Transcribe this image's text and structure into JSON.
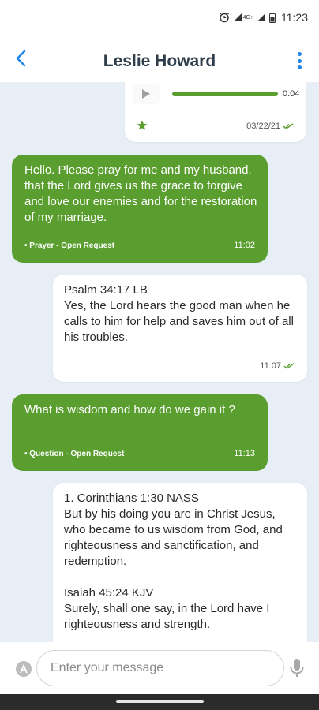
{
  "status": {
    "time": "11:23",
    "network": "4G+"
  },
  "header": {
    "title": "Leslie Howard"
  },
  "messages": [
    {
      "type": "audio",
      "duration": "0:04",
      "date": "03/22/21"
    },
    {
      "type": "incoming",
      "text": "Hello. Please pray for me and my husband, that the Lord gives us the grace to forgive and love our enemies and for the restoration of my marriage.",
      "tag": "• Prayer - Open Request",
      "time": "11:02"
    },
    {
      "type": "outgoing",
      "text": "Psalm 34:17 LB\nYes, the Lord hears the good man when he calls to him for help and saves him out of all his troubles.",
      "time": "11:07"
    },
    {
      "type": "incoming",
      "text": "What is wisdom and how do we gain it ?",
      "tag": "• Question - Open Request",
      "time": "11:13"
    },
    {
      "type": "outgoing",
      "text": "1. Corinthians 1:30 NASS\nBut by his doing you are in Christ Jesus, who became to us wisdom from God, and righteousness and sanctification, and redemption.\n\nIsaiah 45:24 KJV\nSurely, shall one say, in the Lord have I righteousness and strength."
    }
  ],
  "composer": {
    "placeholder": "Enter your message"
  },
  "colors": {
    "accent": "#1e88e5",
    "bubble_green": "#5a9e2f",
    "chat_bg": "#e8eef6",
    "read_check": "#5a9e2f"
  }
}
